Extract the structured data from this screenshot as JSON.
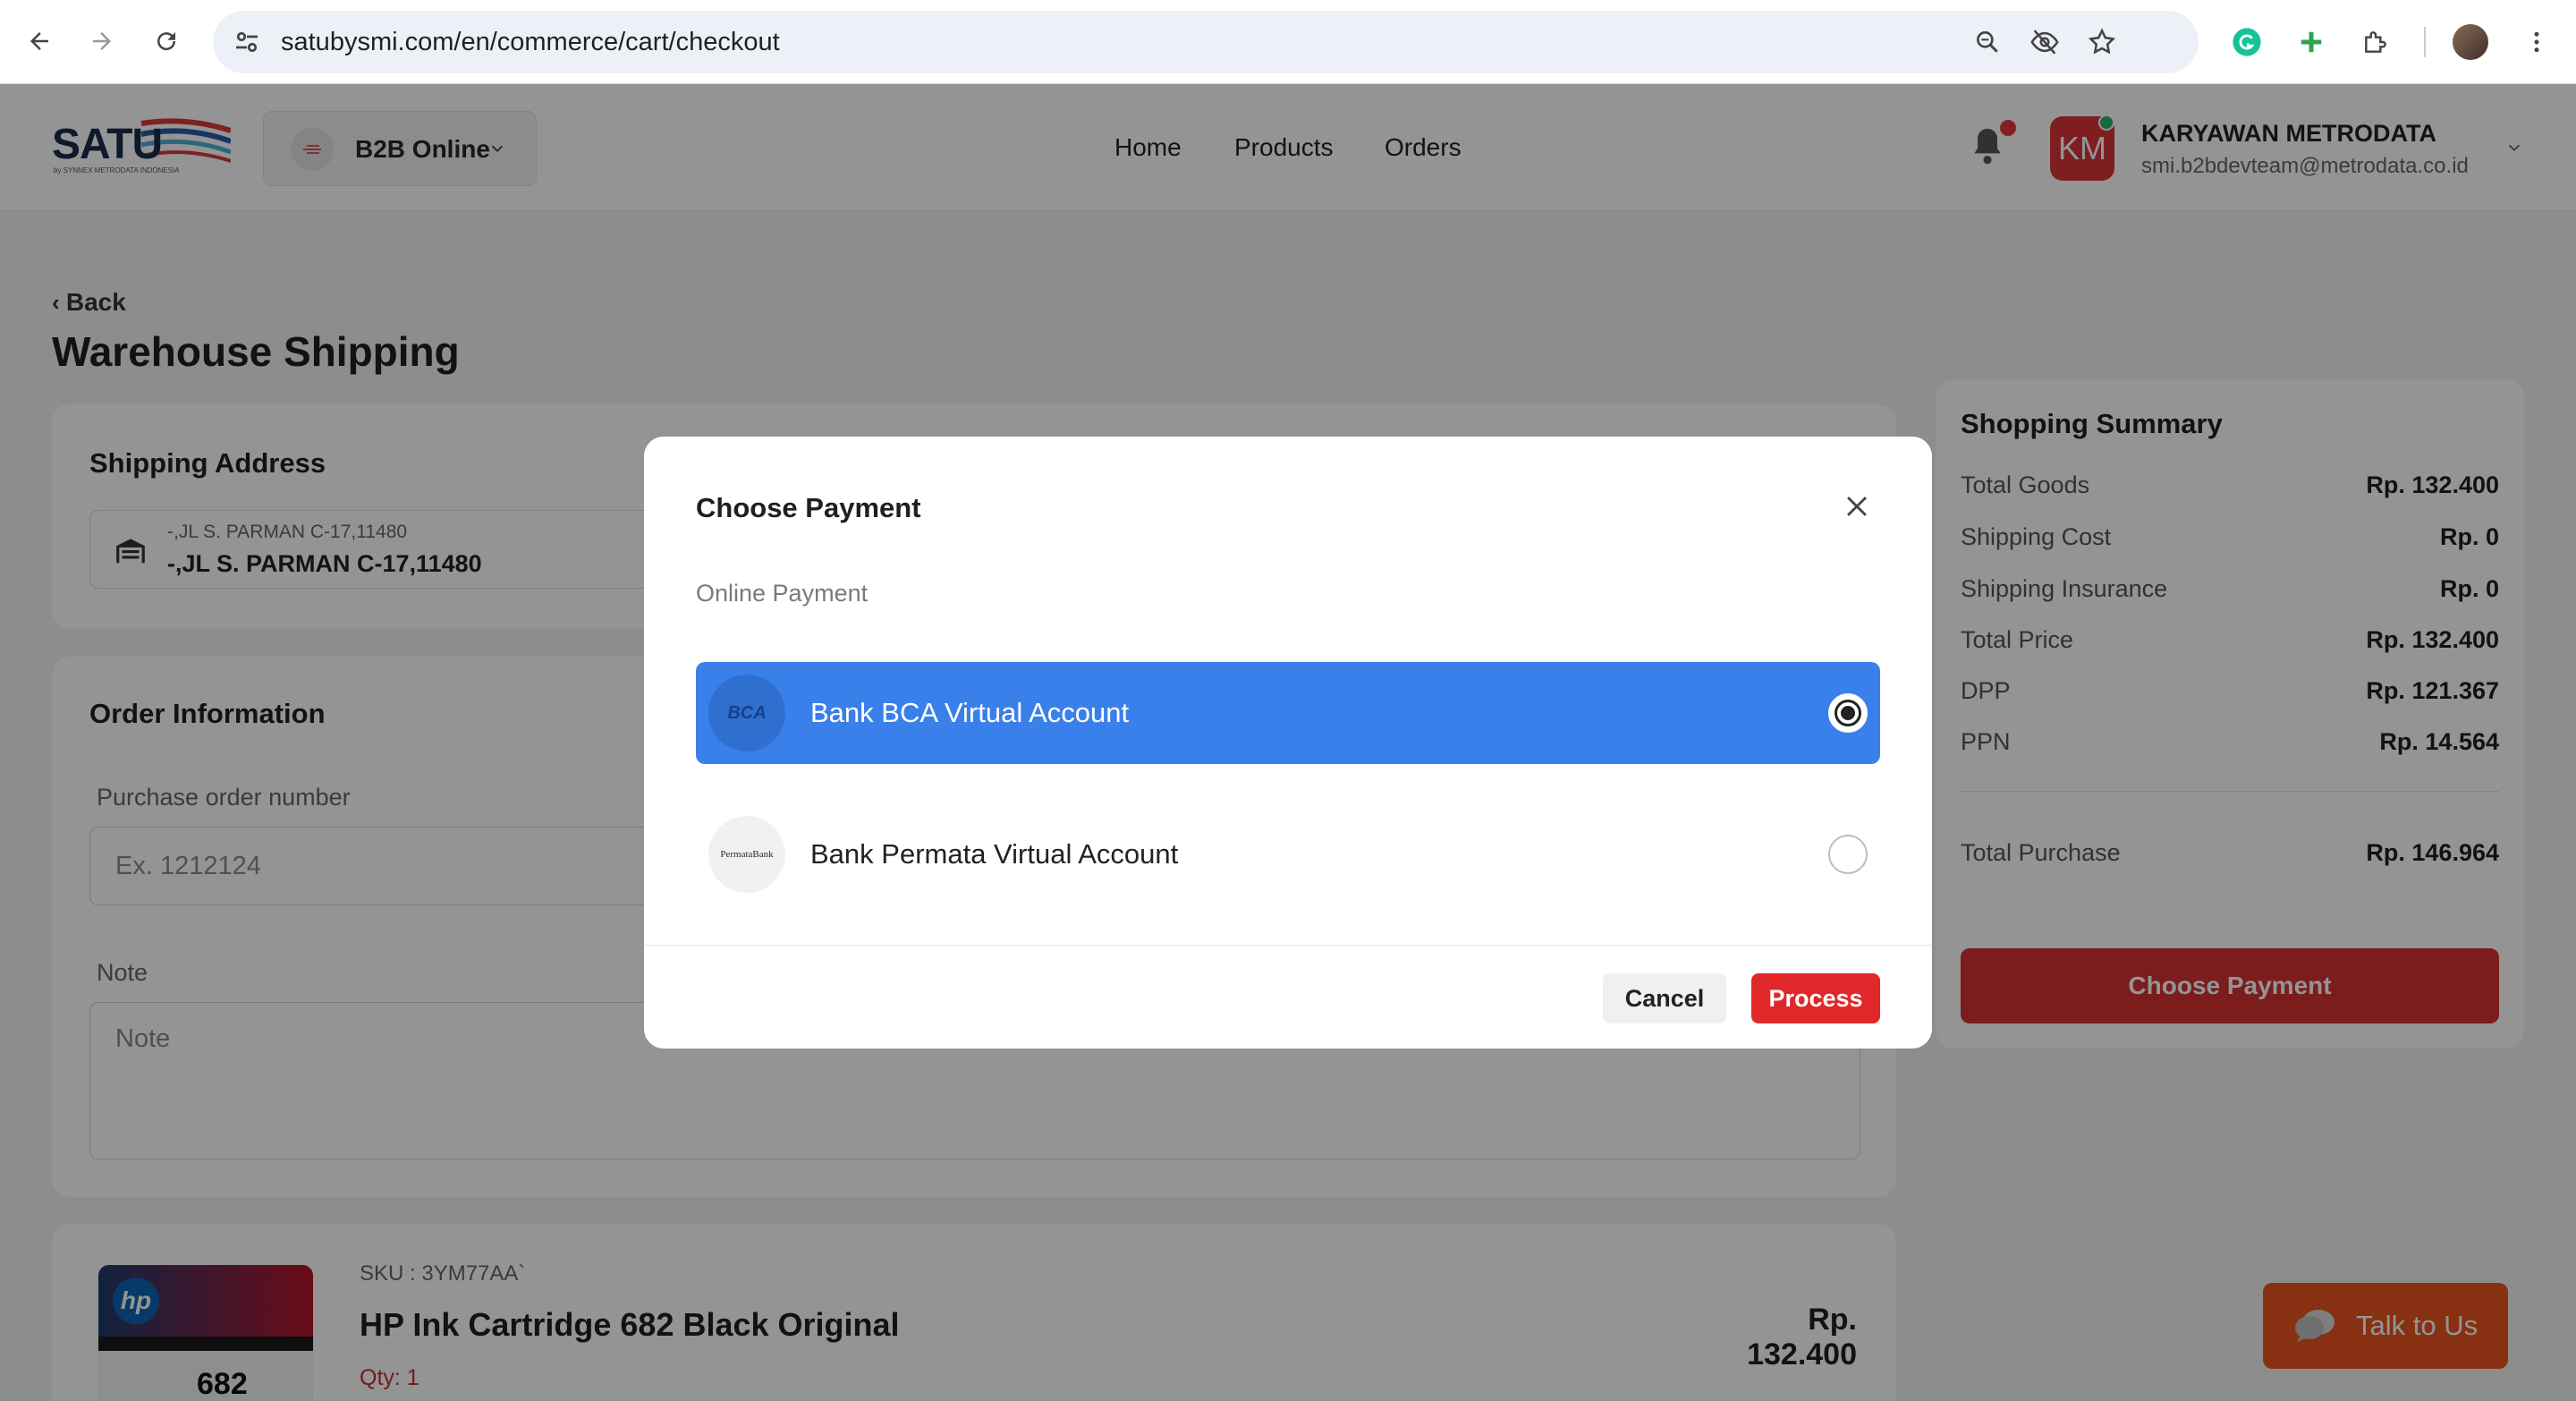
{
  "browser": {
    "url": "satubysmi.com/en/commerce/cart/checkout",
    "icons": [
      "back-icon",
      "forward-icon",
      "reload-icon",
      "site-settings-icon",
      "zoom-icon",
      "eye-off-icon",
      "star-icon",
      "grammarly-icon",
      "plus-extension-icon",
      "puzzle-icon",
      "profile-icon",
      "more-icon"
    ]
  },
  "header": {
    "logo_text": "SATU",
    "logo_sub": "by SYNNEX METRODATA INDONESIA",
    "store_label": "B2B Online",
    "nav": [
      "Home",
      "Products",
      "Orders"
    ],
    "user": {
      "initials": "KM",
      "name": "KARYAWAN METRODATA",
      "email": "smi.b2bdevteam@metrodata.co.id"
    }
  },
  "page": {
    "back_label": "Back",
    "title": "Warehouse Shipping"
  },
  "shipping_address": {
    "title": "Shipping Address",
    "line_small": "-,JL S. PARMAN C-17,11480",
    "line_main": "-,JL S. PARMAN C-17,11480"
  },
  "order_info": {
    "title": "Order Information",
    "po_label": "Purchase order number",
    "po_placeholder": "Ex. 1212124",
    "note_label": "Note",
    "note_placeholder": "Note"
  },
  "summary": {
    "title": "Shopping Summary",
    "rows": [
      {
        "label": "Total Goods",
        "value": "Rp. 132.400"
      },
      {
        "label": "Shipping Cost",
        "value": "Rp. 0"
      },
      {
        "label": "Shipping Insurance",
        "value": "Rp. 0"
      },
      {
        "label": "Total Price",
        "value": "Rp. 132.400"
      },
      {
        "label": "DPP",
        "value": "Rp. 121.367"
      },
      {
        "label": "PPN",
        "value": "Rp. 14.564"
      }
    ],
    "total": {
      "label": "Total Purchase",
      "value": "Rp. 146.964"
    },
    "button": "Choose Payment"
  },
  "product": {
    "sku": "SKU : 3YM77AA`",
    "name": "HP Ink Cartridge 682 Black Original",
    "qty": "Qty: 1",
    "price": "Rp. 132.400",
    "image_text": "682"
  },
  "chat": {
    "label": "Talk to Us"
  },
  "modal": {
    "title": "Choose Payment",
    "section": "Online Payment",
    "options": [
      {
        "label": "Bank BCA Virtual Account",
        "logo": "BCA",
        "selected": true
      },
      {
        "label": "Bank Permata Virtual Account",
        "logo": "PermataBank",
        "selected": false
      }
    ],
    "cancel": "Cancel",
    "process": "Process"
  },
  "colors": {
    "brand_red": "#d63131",
    "selected_blue": "#3a80ea",
    "chat_orange": "#e8551f"
  }
}
